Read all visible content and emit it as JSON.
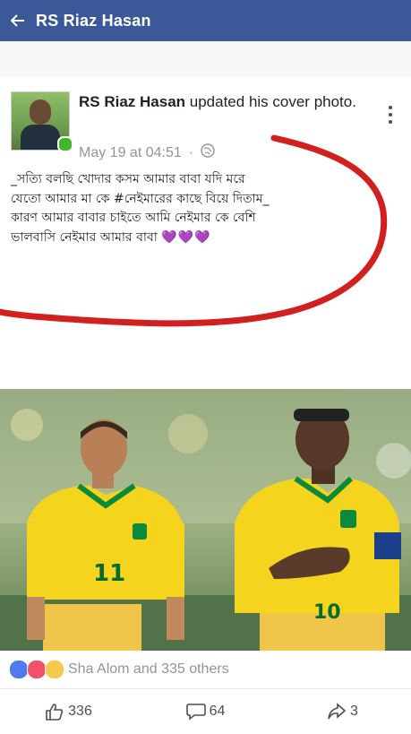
{
  "header": {
    "title": "RS Riaz Hasan"
  },
  "post": {
    "author": "RS Riaz Hasan",
    "action": " updated his cover photo.",
    "timestamp": "May 19 at 04:51",
    "dot": "·",
    "text": "_সত্যি বলছি খোদার কসম আমার বাবা যদি মরে যেতো আমার মা কে #নেইমারের কাছে বিয়ে দিতাম_ কারণ আমার বাবার চাইতে আমি নেইমার কে বেশি ভালবাসি নেইমার আমার বাবা",
    "hearts": "💜💜💜"
  },
  "photo": {
    "left_jersey_number": "11",
    "right_jersey_number": "10"
  },
  "reactions": {
    "summary": "Sha Alom and 335 others"
  },
  "actions": {
    "likes": "336",
    "comments": "64",
    "shares": "3"
  },
  "colors": {
    "facebook_blue": "#3b5998",
    "annotation_red": "#d2201f",
    "jersey_yellow": "#f4d41c",
    "jersey_green": "#0a8a3a"
  },
  "icons": [
    "back-arrow-icon",
    "more-vert-icon",
    "globe-icon",
    "like-reaction-icon",
    "love-reaction-icon",
    "haha-reaction-icon",
    "like-icon",
    "comment-icon",
    "share-icon"
  ]
}
